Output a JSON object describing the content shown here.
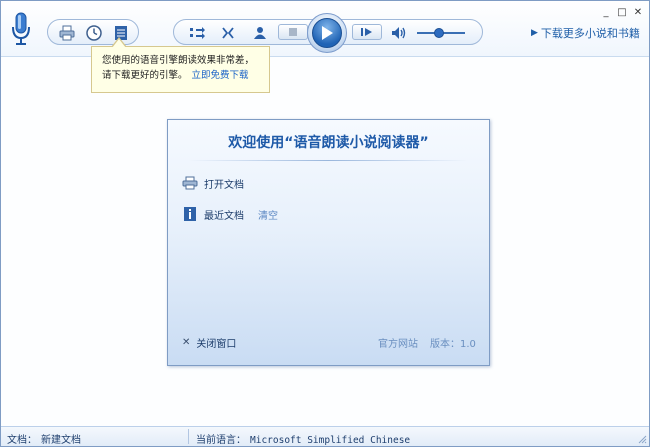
{
  "toolbar": {
    "more_link": "下载更多小说和书籍",
    "window_controls": {
      "minimize": "_",
      "maximize": "□",
      "close": "✕"
    },
    "icons": [
      "microphone-icon",
      "print-icon",
      "clock-icon",
      "list-icon",
      "forward-icon",
      "voice-icon",
      "user-icon",
      "stop-icon",
      "play-icon",
      "next-icon",
      "speaker-icon"
    ]
  },
  "tooltip": {
    "line1": "您使用的语音引擎朗读效果非常差，",
    "line2": "请下载更好的引擎。",
    "link": "立即免费下载"
  },
  "dialog": {
    "title": "欢迎使用“语音朗读小说阅读器”",
    "open_doc": "打开文档",
    "recent_doc": "最近文档",
    "clear": "清空",
    "close_window": "关闭窗口",
    "official_site": "官方网站",
    "version": "版本：1.0"
  },
  "status": {
    "doc_label": "文档：",
    "doc_value": "新建文档",
    "lang_label": "当前语言：",
    "lang_value": "Microsoft Simplified Chinese"
  },
  "colors": {
    "accent": "#1e5aa8",
    "play": "#1f63b5",
    "tooltip_bg": "#ffffe6"
  }
}
